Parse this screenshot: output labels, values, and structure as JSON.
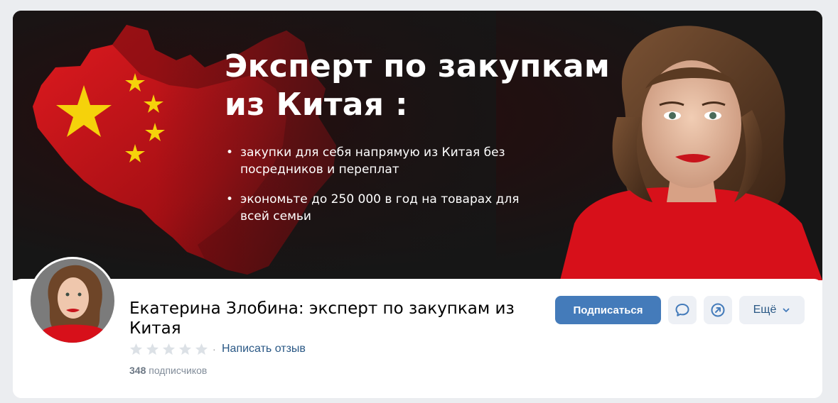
{
  "cover": {
    "title": "Эксперт по закупкам из Китая :",
    "bullets": [
      "закупки для себя напрямую из Китая без посредников и переплат",
      "экономьте до 250 000 в год на товарах для всей семьи"
    ]
  },
  "profile": {
    "name": "Екатерина Злобина: эксперт по закупкам из Китая",
    "review_link": "Написать отзыв",
    "subscribers_count": "348",
    "subscribers_label": "подписчиков",
    "rating_stars": 5,
    "rating_filled": 0
  },
  "actions": {
    "subscribe": "Подписаться",
    "message_icon": "message-bubble-icon",
    "share_icon": "share-arrow-icon",
    "more": "Ещё"
  },
  "colors": {
    "accent": "#447bba",
    "link": "#2a5885",
    "flag_red": "#d4151a",
    "flag_star": "#f5d20b",
    "secondary_button": "#edf0f5"
  }
}
